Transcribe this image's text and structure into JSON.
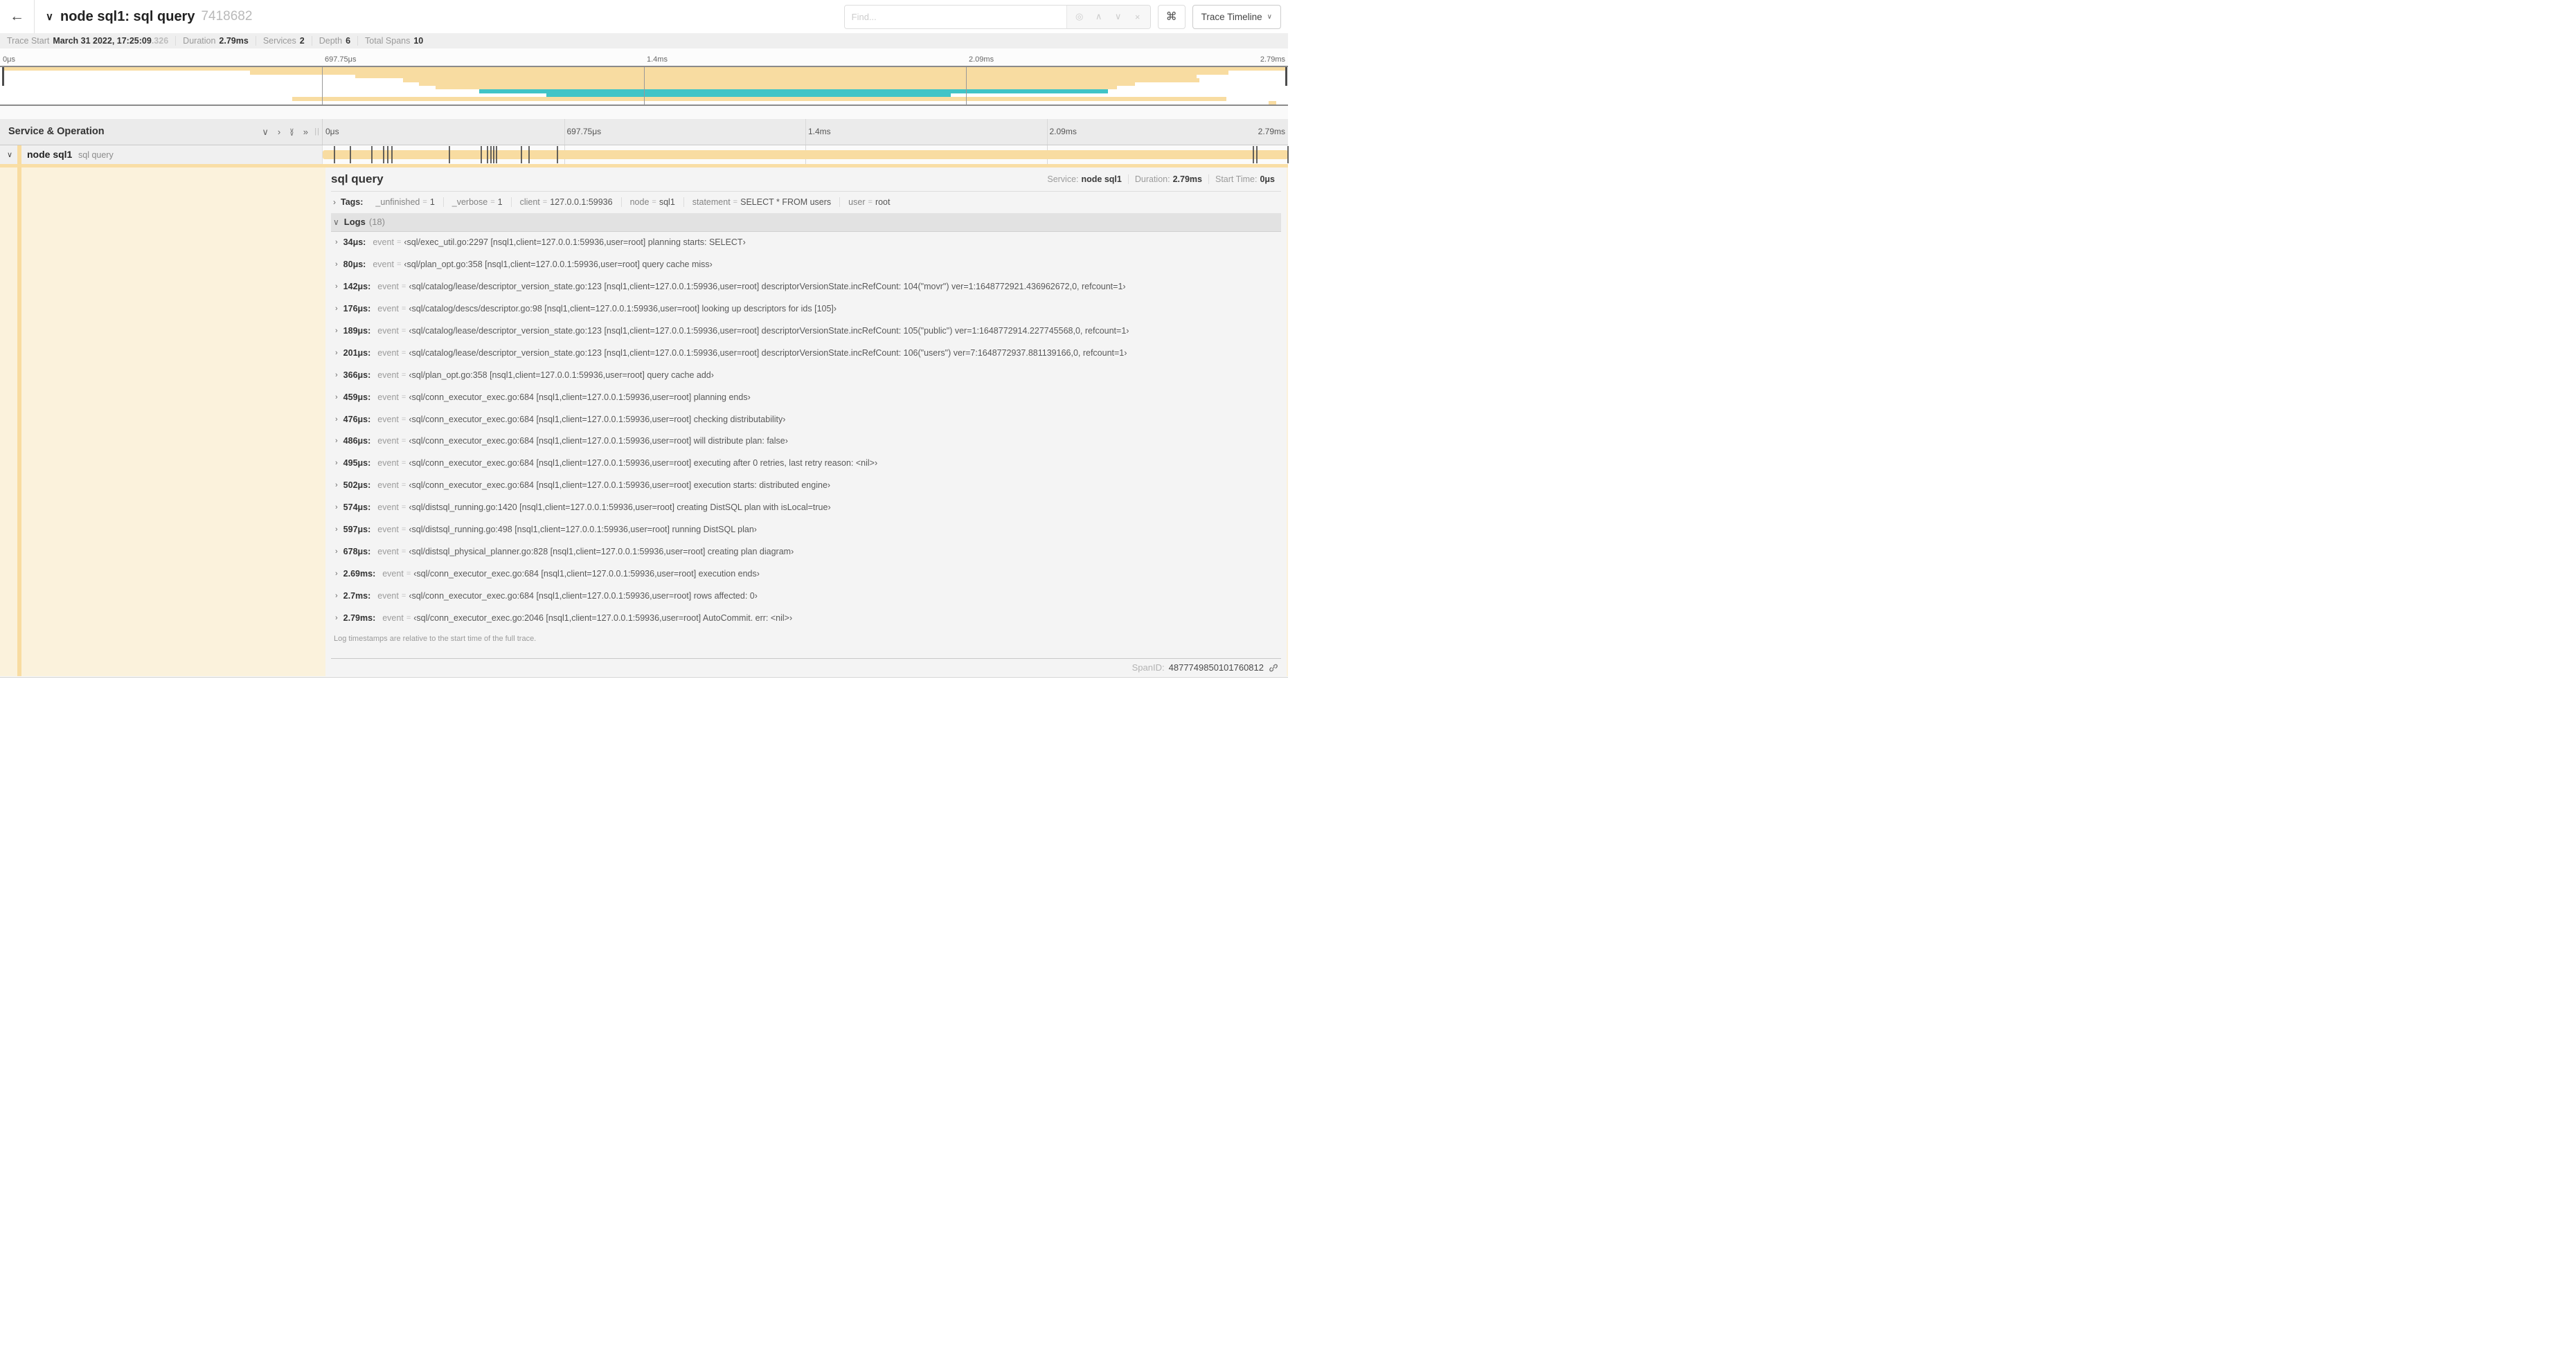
{
  "colors": {
    "tan": "#F8DCA1",
    "teal": "#41C4C7",
    "cream": "#FBF2DC"
  },
  "topbar": {
    "back_icon": "←",
    "collapse_chevron": "∨",
    "title": "node sql1: sql query",
    "trace_id": "7418682",
    "find_placeholder": "Find...",
    "find_icons": [
      {
        "name": "focus-icon",
        "glyph": "◎"
      },
      {
        "name": "prev-result-icon",
        "glyph": "∧"
      },
      {
        "name": "next-result-icon",
        "glyph": "∨"
      },
      {
        "name": "clear-icon",
        "glyph": "×"
      }
    ],
    "shortcut_key": "⌘",
    "view_label": "Trace Timeline",
    "view_chevron": "∨"
  },
  "summary": {
    "items": [
      {
        "label": "Trace Start",
        "value": "March 31 2022, 17:25:09",
        "muted": ".326"
      },
      {
        "label": "Duration",
        "value": "2.79ms"
      },
      {
        "label": "Services",
        "value": "2"
      },
      {
        "label": "Depth",
        "value": "6"
      },
      {
        "label": "Total Spans",
        "value": "10"
      }
    ]
  },
  "timeline": {
    "ticks": [
      "0μs",
      "697.75μs",
      "1.4ms",
      "2.09ms",
      "2.79ms"
    ],
    "total_us": 2790,
    "log_marker_times_us": [
      34,
      80,
      142,
      176,
      189,
      201,
      366,
      459,
      476,
      486,
      495,
      502,
      574,
      597,
      678,
      2690,
      2700,
      2790
    ]
  },
  "minimap": {
    "spans": [
      {
        "start_pct": 0.3,
        "end_pct": 99.8,
        "color": "tan"
      },
      {
        "start_pct": 19.4,
        "end_pct": 95.4,
        "color": "tan"
      },
      {
        "start_pct": 27.6,
        "end_pct": 92.9,
        "color": "tan"
      },
      {
        "start_pct": 31.3,
        "end_pct": 93.1,
        "color": "tan"
      },
      {
        "start_pct": 32.5,
        "end_pct": 88.1,
        "color": "tan"
      },
      {
        "start_pct": 33.8,
        "end_pct": 86.7,
        "color": "tan"
      },
      {
        "start_pct": 37.2,
        "end_pct": 86.0,
        "color": "teal"
      },
      {
        "start_pct": 42.4,
        "end_pct": 73.8,
        "color": "teal"
      },
      {
        "start_pct": 22.7,
        "end_pct": 95.2,
        "color": "tan"
      },
      {
        "start_pct": 98.5,
        "end_pct": 99.1,
        "color": "tan"
      }
    ]
  },
  "grid": {
    "left_header": "Service & Operation",
    "resizer": "||",
    "icons": [
      {
        "name": "collapse-one-icon",
        "glyph": "∨"
      },
      {
        "name": "expand-one-icon",
        "glyph": "›"
      },
      {
        "name": "collapse-all-icon",
        "glyph": "∨∨"
      },
      {
        "name": "expand-all-icon",
        "glyph": "»"
      }
    ]
  },
  "span_row": {
    "chevron": "∨",
    "service": "node sql1",
    "operation": "sql query"
  },
  "detail": {
    "title": "sql query",
    "overview": [
      {
        "label": "Service:",
        "value": "node sql1"
      },
      {
        "label": "Duration:",
        "value": "2.79ms"
      },
      {
        "label": "Start Time:",
        "value": "0μs"
      }
    ],
    "tags": {
      "chevron": "›",
      "label": "Tags:",
      "items": [
        {
          "key": "_unfinished",
          "value": "1"
        },
        {
          "key": "_verbose",
          "value": "1"
        },
        {
          "key": "client",
          "value": "127.0.0.1:59936"
        },
        {
          "key": "node",
          "value": "sql1"
        },
        {
          "key": "statement",
          "value": "SELECT * FROM users"
        },
        {
          "key": "user",
          "value": "root"
        }
      ]
    },
    "logs": {
      "chevron": "∨",
      "label": "Logs",
      "count": "(18)",
      "row_chevron": "›",
      "field": "event",
      "rows": [
        {
          "time": "34μs:",
          "value": "‹sql/exec_util.go:2297 [nsql1,client=127.0.0.1:59936,user=root] planning starts: SELECT›"
        },
        {
          "time": "80μs:",
          "value": "‹sql/plan_opt.go:358 [nsql1,client=127.0.0.1:59936,user=root] query cache miss›"
        },
        {
          "time": "142μs:",
          "value": "‹sql/catalog/lease/descriptor_version_state.go:123 [nsql1,client=127.0.0.1:59936,user=root] descriptorVersionState.incRefCount: 104(\"movr\") ver=1:1648772921.436962672,0, refcount=1›"
        },
        {
          "time": "176μs:",
          "value": "‹sql/catalog/descs/descriptor.go:98 [nsql1,client=127.0.0.1:59936,user=root] looking up descriptors for ids [105]›"
        },
        {
          "time": "189μs:",
          "value": "‹sql/catalog/lease/descriptor_version_state.go:123 [nsql1,client=127.0.0.1:59936,user=root] descriptorVersionState.incRefCount: 105(\"public\") ver=1:1648772914.227745568,0, refcount=1›"
        },
        {
          "time": "201μs:",
          "value": "‹sql/catalog/lease/descriptor_version_state.go:123 [nsql1,client=127.0.0.1:59936,user=root] descriptorVersionState.incRefCount: 106(\"users\") ver=7:1648772937.881139166,0, refcount=1›"
        },
        {
          "time": "366μs:",
          "value": "‹sql/plan_opt.go:358 [nsql1,client=127.0.0.1:59936,user=root] query cache add›"
        },
        {
          "time": "459μs:",
          "value": "‹sql/conn_executor_exec.go:684 [nsql1,client=127.0.0.1:59936,user=root] planning ends›"
        },
        {
          "time": "476μs:",
          "value": "‹sql/conn_executor_exec.go:684 [nsql1,client=127.0.0.1:59936,user=root] checking distributability›"
        },
        {
          "time": "486μs:",
          "value": "‹sql/conn_executor_exec.go:684 [nsql1,client=127.0.0.1:59936,user=root] will distribute plan: false›"
        },
        {
          "time": "495μs:",
          "value": "‹sql/conn_executor_exec.go:684 [nsql1,client=127.0.0.1:59936,user=root] executing after 0 retries, last retry reason: <nil>›"
        },
        {
          "time": "502μs:",
          "value": "‹sql/conn_executor_exec.go:684 [nsql1,client=127.0.0.1:59936,user=root] execution starts: distributed engine›"
        },
        {
          "time": "574μs:",
          "value": "‹sql/distsql_running.go:1420 [nsql1,client=127.0.0.1:59936,user=root] creating DistSQL plan with isLocal=true›"
        },
        {
          "time": "597μs:",
          "value": "‹sql/distsql_running.go:498 [nsql1,client=127.0.0.1:59936,user=root] running DistSQL plan›"
        },
        {
          "time": "678μs:",
          "value": "‹sql/distsql_physical_planner.go:828 [nsql1,client=127.0.0.1:59936,user=root] creating plan diagram›"
        },
        {
          "time": "2.69ms:",
          "value": "‹sql/conn_executor_exec.go:684 [nsql1,client=127.0.0.1:59936,user=root] execution ends›"
        },
        {
          "time": "2.7ms:",
          "value": "‹sql/conn_executor_exec.go:684 [nsql1,client=127.0.0.1:59936,user=root] rows affected: 0›"
        },
        {
          "time": "2.79ms:",
          "value": "‹sql/conn_executor_exec.go:2046 [nsql1,client=127.0.0.1:59936,user=root] AutoCommit. err: <nil>›"
        }
      ],
      "footnote": "Log timestamps are relative to the start time of the full trace."
    },
    "span_id": {
      "label": "SpanID:",
      "value": "4877749850101760812"
    }
  }
}
